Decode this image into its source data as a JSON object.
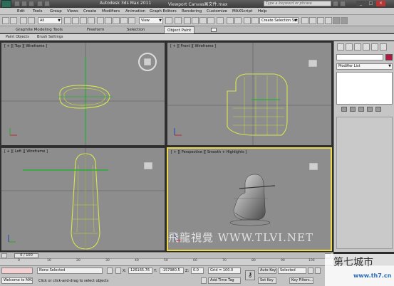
{
  "window": {
    "app_title": "Autodesk 3ds Max  2011",
    "file_title": "Viewport Canvas画文件.max",
    "search_placeholder": "Type a keyword or phrase"
  },
  "menu": [
    "Edit",
    "Tools",
    "Group",
    "Views",
    "Create",
    "Modifiers",
    "Animation",
    "Graph Editors",
    "Rendering",
    "Customize",
    "MAXScript",
    "Help"
  ],
  "toolbar": {
    "selection_filter": "All",
    "reference_coord": "View",
    "selection_set": "Create Selection Set"
  },
  "ribbon": {
    "tabs": [
      "Graphite Modeling Tools",
      "Freeform",
      "Selection",
      "Object Paint"
    ],
    "active_tab": "Object Paint",
    "subtabs": [
      "Paint Objects",
      "Brush Settings"
    ]
  },
  "viewports": {
    "top": "[ + ][ Top ][ Wireframe ]",
    "front": "[ + ][ Front ][ Wireframe ]",
    "left": "[ + ][ Left ][ Wireframe ]",
    "perspective": "[ + ][ Perspective ][ Smooth + Highlights ]"
  },
  "command_panel": {
    "modifier_list": "Modifier List",
    "object_color": "#b5183f"
  },
  "timeline": {
    "frame_readout": "0 / 100",
    "ticks": [
      "0",
      "10",
      "20",
      "30",
      "40",
      "50",
      "60",
      "70",
      "80",
      "90",
      "100"
    ]
  },
  "status": {
    "welcome": "Welcome to MAX",
    "selection": "None Selected",
    "prompt": "Click or click-and-drag to select objects",
    "x_label": "X:",
    "x_value": "126165.76",
    "y_label": "Y:",
    "y_value": "-157980.5",
    "z_label": "Z:",
    "z_value": "0.0",
    "grid": "Grid = 100.0",
    "add_time_tag": "Add Time Tag",
    "auto_key": "Auto Key",
    "set_key": "Set Key",
    "selected": "Selected",
    "key_filters": "Key Filters..."
  },
  "watermarks": {
    "site": "飛龍視覺 WWW.TLVI.NET",
    "brand": "第七城市",
    "brand_url": "www.th7.cn"
  }
}
